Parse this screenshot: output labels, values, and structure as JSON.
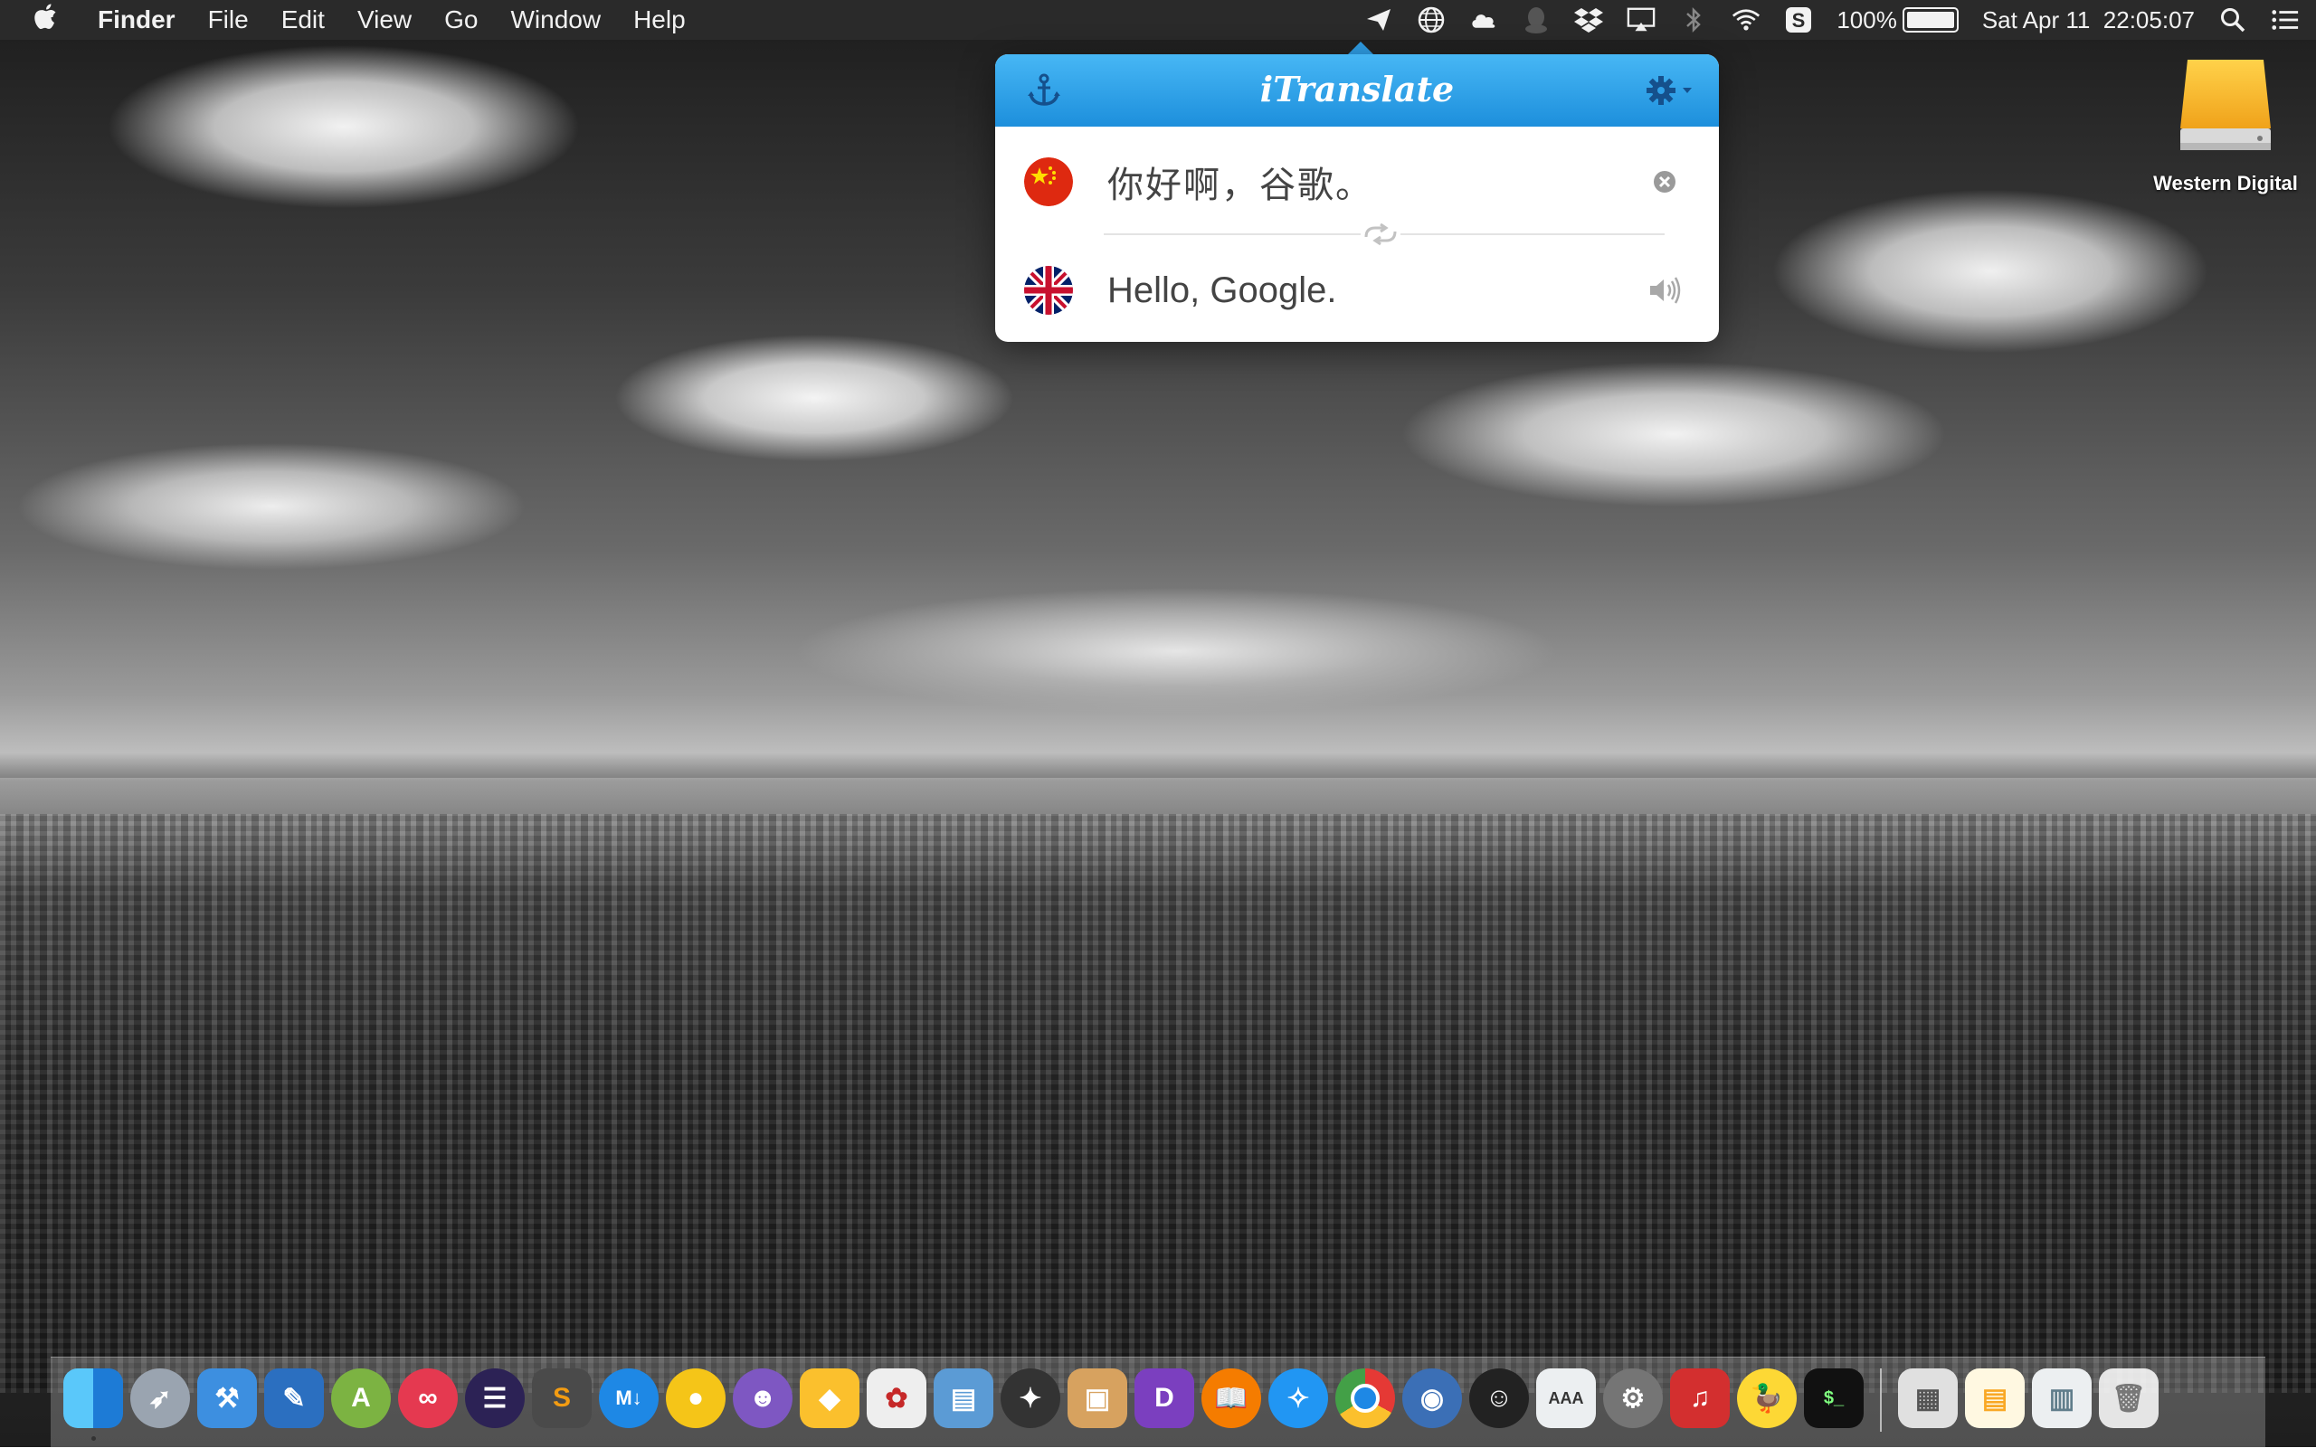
{
  "menubar": {
    "app_name": "Finder",
    "menus": [
      "File",
      "Edit",
      "View",
      "Go",
      "Window",
      "Help"
    ],
    "battery_percent": "100%",
    "datetime": "Sat Apr 11  22:05:07",
    "status_icons": [
      "paper-plane-icon",
      "globe-icon",
      "cloud-icon",
      "qq-icon",
      "dropbox-icon",
      "airplay-icon",
      "bluetooth-icon",
      "wifi-icon",
      "s-app-icon",
      "battery-icon",
      "spotlight-icon",
      "notification-center-icon"
    ]
  },
  "itranslate": {
    "title": "iTranslate",
    "source_text": "你好啊，谷歌。",
    "target_text": "Hello, Google.",
    "source_language_flag": "china-flag",
    "target_language_flag": "uk-flag",
    "accent_color": "#2f9ee6"
  },
  "desktop": {
    "drive_label": "Western Digital"
  },
  "dock": {
    "apps": [
      "finder",
      "launchpad",
      "xcode",
      "instruments",
      "android-studio",
      "flickr",
      "eclipse",
      "sublime-text",
      "macdown",
      "paw",
      "github",
      "sketch",
      "photo-app",
      "keynote",
      "compass",
      "package",
      "dash",
      "ibooks",
      "safari",
      "chrome",
      "tweetbot",
      "qq",
      "font-app",
      "system-preferences",
      "netease-music",
      "cyberduck",
      "terminal",
      "downloads-stack",
      "documents-stack",
      "screenshots-stack",
      "trash"
    ]
  }
}
